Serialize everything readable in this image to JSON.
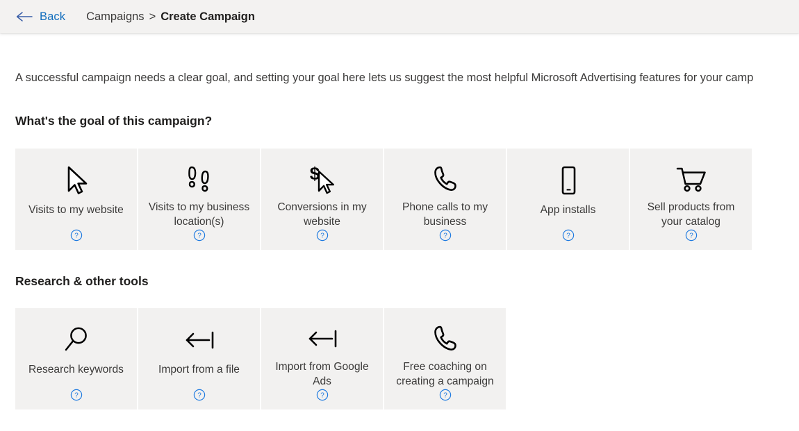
{
  "topbar": {
    "back_label": "Back",
    "back_icon": "arrow-left-icon",
    "breadcrumb": {
      "parent": "Campaigns",
      "separator": ">",
      "current": "Create Campaign"
    }
  },
  "main": {
    "intro": "A successful campaign needs a clear goal, and setting your goal here lets us suggest the most helpful Microsoft Advertising features for your camp",
    "goal_section": {
      "title": "What's the goal of this campaign?",
      "tiles": [
        {
          "label": "Visits to my website",
          "icon": "cursor-pointer-icon",
          "help_icon": "help-circle-icon"
        },
        {
          "label": "Visits to my business location(s)",
          "icon": "footprints-icon",
          "help_icon": "help-circle-icon"
        },
        {
          "label": "Conversions in my website",
          "icon": "dollar-cursor-icon",
          "help_icon": "help-circle-icon"
        },
        {
          "label": "Phone calls to my business",
          "icon": "phone-icon",
          "help_icon": "help-circle-icon"
        },
        {
          "label": "App installs",
          "icon": "mobile-phone-icon",
          "help_icon": "help-circle-icon"
        },
        {
          "label": "Sell products from your catalog",
          "icon": "shopping-cart-icon",
          "help_icon": "help-circle-icon"
        }
      ]
    },
    "tools_section": {
      "title": "Research & other tools",
      "tiles": [
        {
          "label": "Research keywords",
          "icon": "magnifier-icon",
          "help_icon": "help-circle-icon"
        },
        {
          "label": "Import from a file",
          "icon": "import-arrow-icon",
          "help_icon": "help-circle-icon"
        },
        {
          "label": "Import from Google Ads",
          "icon": "import-arrow-icon",
          "help_icon": "help-circle-icon"
        },
        {
          "label": "Free coaching on creating a campaign",
          "icon": "phone-icon",
          "help_icon": "help-circle-icon"
        }
      ]
    }
  },
  "colors": {
    "link": "#0f6cbd",
    "tile_bg": "#f2f1f0",
    "topbar_bg": "#f3f2f1",
    "text": "#3b3a39",
    "help_icon": "#1e7ae0"
  }
}
